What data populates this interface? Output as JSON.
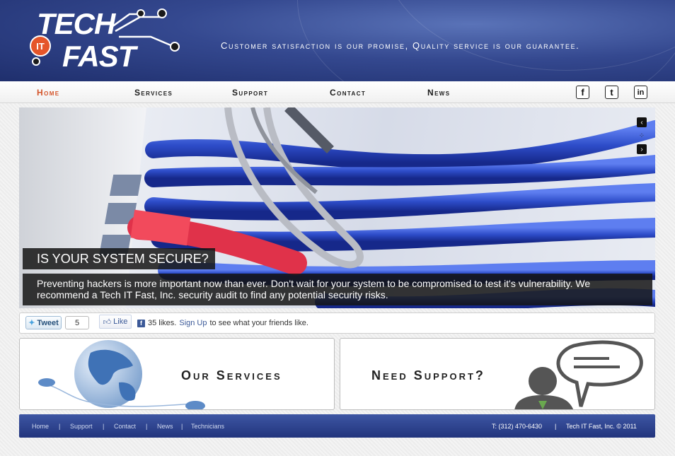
{
  "header": {
    "logo": {
      "line1": "TECH",
      "badge": "IT",
      "line2": "FAST"
    },
    "tagline": "Customer satisfaction is our promise, Quality service is our guarantee."
  },
  "nav": {
    "items": [
      {
        "label": "Home",
        "active": true
      },
      {
        "label": "Services",
        "active": false
      },
      {
        "label": "Support",
        "active": false
      },
      {
        "label": "Contact",
        "active": false
      },
      {
        "label": "News",
        "active": false
      }
    ],
    "social": [
      {
        "icon": "facebook-icon",
        "glyph": "f"
      },
      {
        "icon": "twitter-icon",
        "glyph": "t"
      },
      {
        "icon": "linkedin-icon",
        "glyph": "in"
      }
    ]
  },
  "slider": {
    "title": "IS YOUR SYSTEM SECURE?",
    "body": "Preventing hackers is more important now than ever. Don't wait for your system to be compromised to test it's vulnerability. We recommend a Tech IT Fast, Inc. security audit to find any potential security risks.",
    "controls": {
      "prev": "‹",
      "pause": "⁘",
      "next": "›"
    }
  },
  "social_bar": {
    "tweet_label": "Tweet",
    "tweet_count": "5",
    "like_label": "Like",
    "like_count_text": "35 likes.",
    "signup_link": "Sign Up",
    "signup_suffix": "to see what your friends like."
  },
  "panels": {
    "services_title": "Our Services",
    "support_title": "Need Support?"
  },
  "footer": {
    "links": [
      "Home",
      "Support",
      "Contact",
      "News",
      "Technicians"
    ],
    "separator": "|",
    "phone": "T: (312) 470-6430",
    "copyright": "Tech IT Fast, Inc. © 2011"
  },
  "colors": {
    "brand_blue": "#34488f",
    "accent_orange": "#d4542a",
    "cable_blue": "#2f4fc4",
    "cable_red": "#e0324a"
  }
}
